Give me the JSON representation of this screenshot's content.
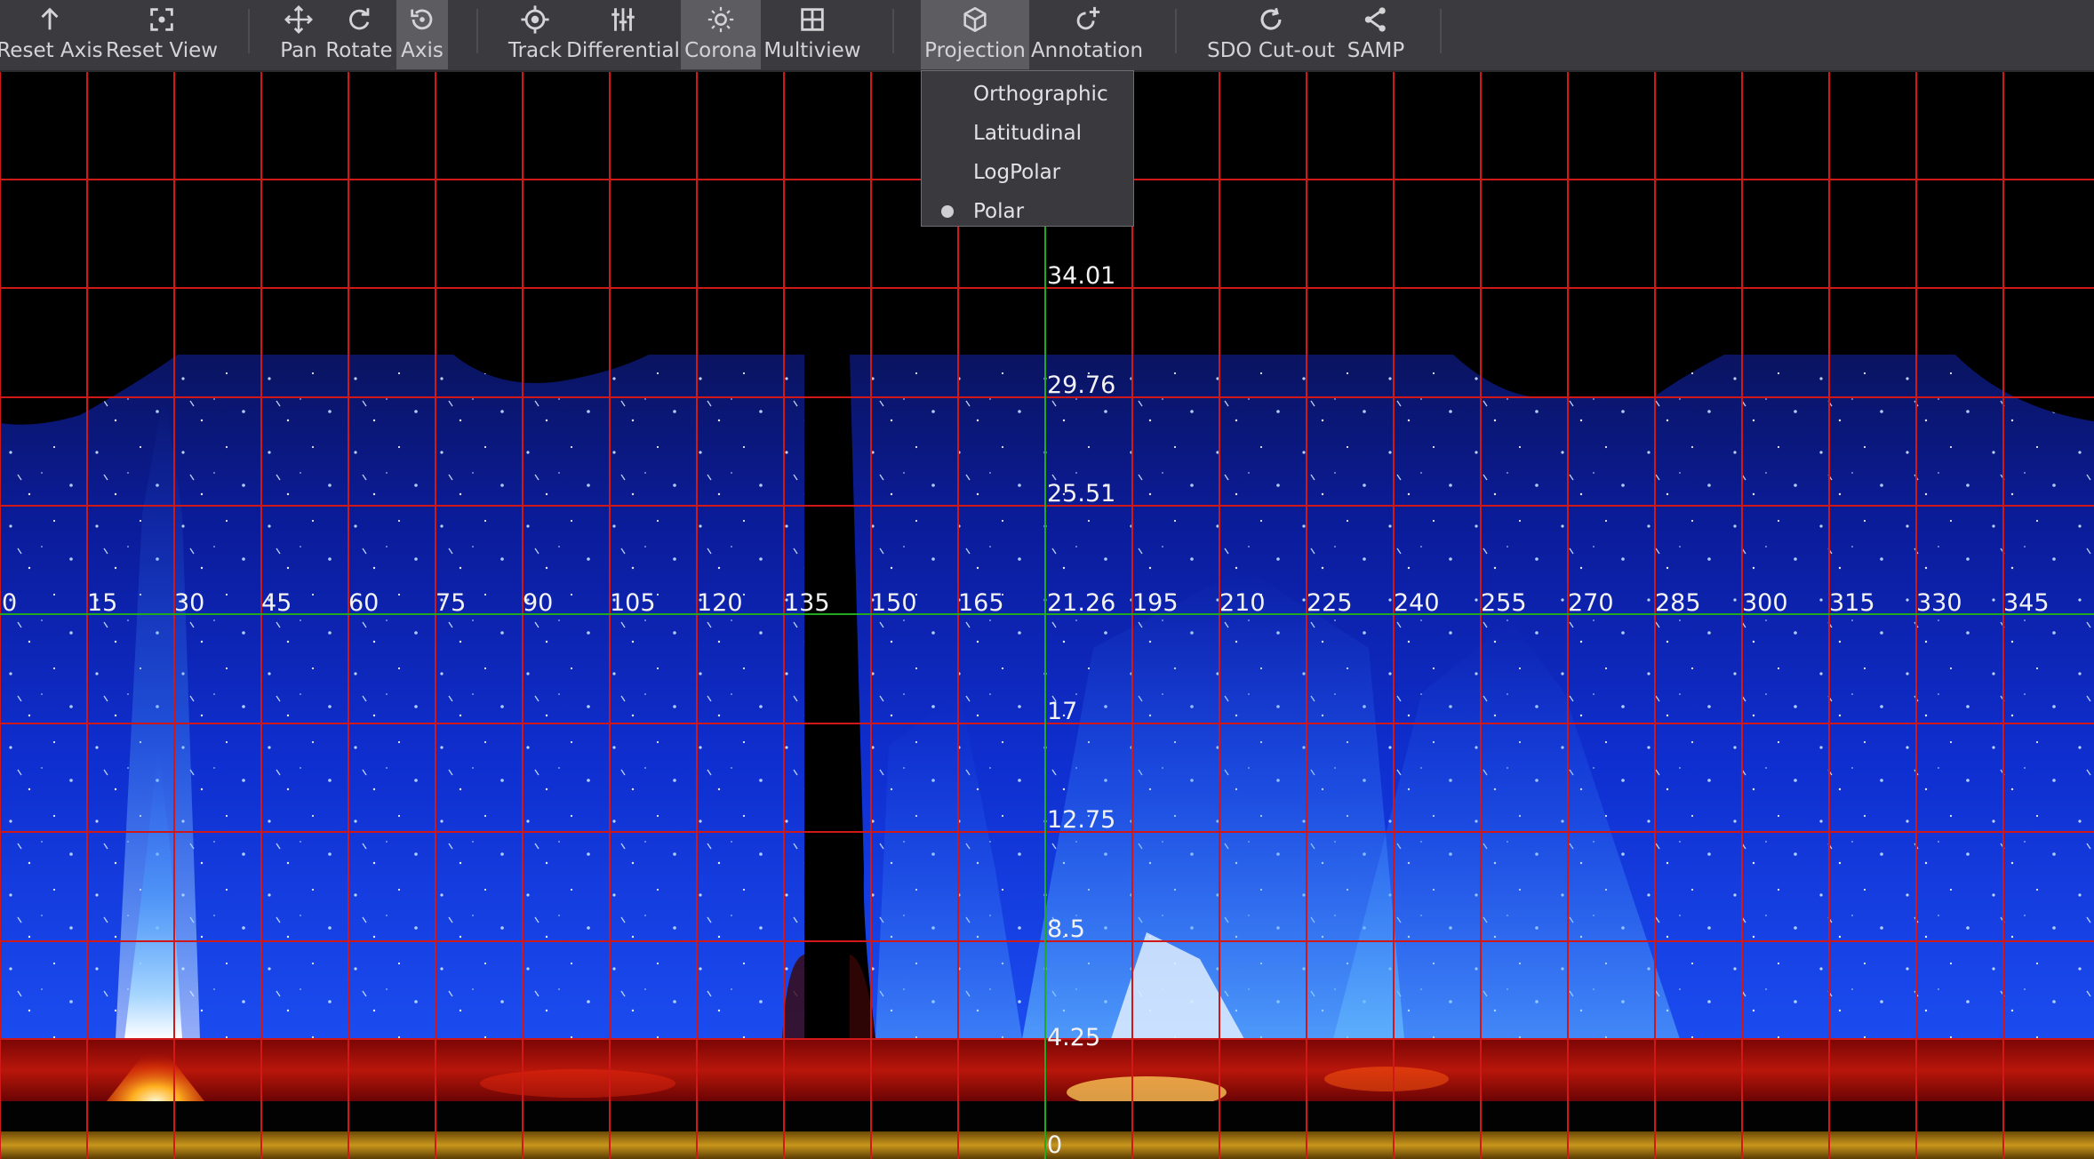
{
  "toolbar": {
    "buttons": [
      {
        "id": "reset-axis",
        "label": "Reset Axis",
        "icon": "arrow-up-icon",
        "active": false
      },
      {
        "id": "reset-view",
        "label": "Reset View",
        "icon": "focus-frame-icon",
        "active": false
      },
      {
        "id": "pan",
        "label": "Pan",
        "icon": "move-arrows-icon",
        "active": false
      },
      {
        "id": "rotate",
        "label": "Rotate",
        "icon": "rotate-icon",
        "active": false
      },
      {
        "id": "axis",
        "label": "Axis",
        "icon": "axis-rotate-icon",
        "active": true
      },
      {
        "id": "track",
        "label": "Track",
        "icon": "crosshair-icon",
        "active": false
      },
      {
        "id": "differential",
        "label": "Differential",
        "icon": "differential-icon",
        "active": false
      },
      {
        "id": "corona",
        "label": "Corona",
        "icon": "sun-icon",
        "active": true
      },
      {
        "id": "multiview",
        "label": "Multiview",
        "icon": "grid-icon",
        "active": false
      },
      {
        "id": "projection",
        "label": "Projection",
        "icon": "cube-icon",
        "active": true
      },
      {
        "id": "annotation",
        "label": "Annotation",
        "icon": "annotate-icon",
        "active": false
      },
      {
        "id": "sdo-cutout",
        "label": "SDO Cut-out",
        "icon": "cutout-icon",
        "active": false
      },
      {
        "id": "samp",
        "label": "SAMP",
        "icon": "share-icon",
        "active": false
      }
    ]
  },
  "projection_menu": {
    "items": [
      {
        "label": "Orthographic",
        "selected": false
      },
      {
        "label": "Latitudinal",
        "selected": false
      },
      {
        "label": "LogPolar",
        "selected": false
      },
      {
        "label": "Polar",
        "selected": true
      }
    ]
  },
  "polar_view": {
    "longitude_labels": [
      "0",
      "15",
      "30",
      "45",
      "60",
      "75",
      "90",
      "105",
      "120",
      "135",
      "150",
      "165",
      "21.26",
      "195",
      "210",
      "225",
      "240",
      "255",
      "270",
      "285",
      "300",
      "315",
      "330",
      "345"
    ],
    "radius_labels": [
      "34.01",
      "29.76",
      "25.51",
      "21.26",
      "17",
      "12.75",
      "8.5",
      "4.25",
      "0"
    ],
    "colors": {
      "grid": "#d01818",
      "axis": "#1faa1f",
      "corona": "#1a2ee0",
      "corona_bright": "#3fa0ff",
      "euv": "#c01010",
      "surface": "#b8860b",
      "toolbar": "#3b3b3f"
    }
  }
}
